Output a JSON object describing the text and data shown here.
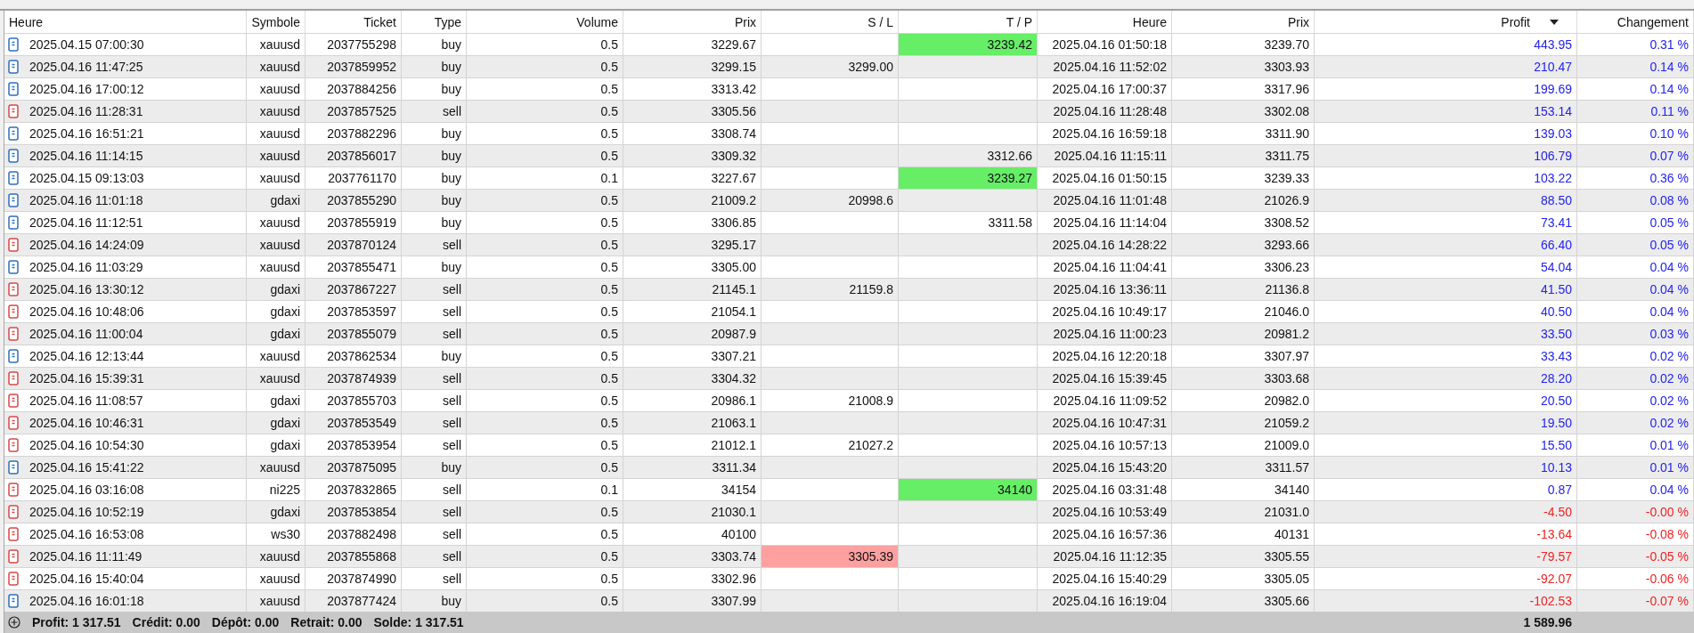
{
  "columns": [
    {
      "label": "Heure",
      "sorted": false
    },
    {
      "label": "Symbole",
      "sorted": false
    },
    {
      "label": "Ticket",
      "sorted": false
    },
    {
      "label": "Type",
      "sorted": false
    },
    {
      "label": "Volume",
      "sorted": false
    },
    {
      "label": "Prix",
      "sorted": false
    },
    {
      "label": "S / L",
      "sorted": false
    },
    {
      "label": "T / P",
      "sorted": false
    },
    {
      "label": "Heure",
      "sorted": false
    },
    {
      "label": "Prix",
      "sorted": false
    },
    {
      "label": "Profit",
      "sorted": true
    },
    {
      "label": "Changement",
      "sorted": false
    }
  ],
  "rows": [
    {
      "kind": "buy",
      "open_time": "2025.04.15 07:00:30",
      "symbol": "xauusd",
      "ticket": "2037755298",
      "type": "buy",
      "volume": "0.5",
      "open_price": "3229.67",
      "tp": {
        "value": "3239.42",
        "hit": true
      },
      "close_time": "2025.04.16 01:50:18",
      "close_price": "3239.70",
      "profit": "443.95",
      "change": "0.31 %",
      "loss": false
    },
    {
      "kind": "buy",
      "open_time": "2025.04.16 11:47:25",
      "symbol": "xauusd",
      "ticket": "2037859952",
      "type": "buy",
      "volume": "0.5",
      "open_price": "3299.15",
      "sl": {
        "value": "3299.00",
        "hit": false
      },
      "close_time": "2025.04.16 11:52:02",
      "close_price": "3303.93",
      "profit": "210.47",
      "change": "0.14 %",
      "loss": false
    },
    {
      "kind": "buy",
      "open_time": "2025.04.16 17:00:12",
      "symbol": "xauusd",
      "ticket": "2037884256",
      "type": "buy",
      "volume": "0.5",
      "open_price": "3313.42",
      "close_time": "2025.04.16 17:00:37",
      "close_price": "3317.96",
      "profit": "199.69",
      "change": "0.14 %",
      "loss": false
    },
    {
      "kind": "sell",
      "open_time": "2025.04.16 11:28:31",
      "symbol": "xauusd",
      "ticket": "2037857525",
      "type": "sell",
      "volume": "0.5",
      "open_price": "3305.56",
      "close_time": "2025.04.16 11:28:48",
      "close_price": "3302.08",
      "profit": "153.14",
      "change": "0.11 %",
      "loss": false
    },
    {
      "kind": "buy",
      "open_time": "2025.04.16 16:51:21",
      "symbol": "xauusd",
      "ticket": "2037882296",
      "type": "buy",
      "volume": "0.5",
      "open_price": "3308.74",
      "close_time": "2025.04.16 16:59:18",
      "close_price": "3311.90",
      "profit": "139.03",
      "change": "0.10 %",
      "loss": false
    },
    {
      "kind": "buy",
      "open_time": "2025.04.16 11:14:15",
      "symbol": "xauusd",
      "ticket": "2037856017",
      "type": "buy",
      "volume": "0.5",
      "open_price": "3309.32",
      "tp": {
        "value": "3312.66",
        "hit": false
      },
      "close_time": "2025.04.16 11:15:11",
      "close_price": "3311.75",
      "profit": "106.79",
      "change": "0.07 %",
      "loss": false
    },
    {
      "kind": "buy",
      "open_time": "2025.04.15 09:13:03",
      "symbol": "xauusd",
      "ticket": "2037761170",
      "type": "buy",
      "volume": "0.1",
      "open_price": "3227.67",
      "tp": {
        "value": "3239.27",
        "hit": true
      },
      "close_time": "2025.04.16 01:50:15",
      "close_price": "3239.33",
      "profit": "103.22",
      "change": "0.36 %",
      "loss": false
    },
    {
      "kind": "buy",
      "open_time": "2025.04.16 11:01:18",
      "symbol": "gdaxi",
      "ticket": "2037855290",
      "type": "buy",
      "volume": "0.5",
      "open_price": "21009.2",
      "sl": {
        "value": "20998.6",
        "hit": false
      },
      "close_time": "2025.04.16 11:01:48",
      "close_price": "21026.9",
      "profit": "88.50",
      "change": "0.08 %",
      "loss": false
    },
    {
      "kind": "buy",
      "open_time": "2025.04.16 11:12:51",
      "symbol": "xauusd",
      "ticket": "2037855919",
      "type": "buy",
      "volume": "0.5",
      "open_price": "3306.85",
      "tp": {
        "value": "3311.58",
        "hit": false
      },
      "close_time": "2025.04.16 11:14:04",
      "close_price": "3308.52",
      "profit": "73.41",
      "change": "0.05 %",
      "loss": false
    },
    {
      "kind": "sell",
      "open_time": "2025.04.16 14:24:09",
      "symbol": "xauusd",
      "ticket": "2037870124",
      "type": "sell",
      "volume": "0.5",
      "open_price": "3295.17",
      "close_time": "2025.04.16 14:28:22",
      "close_price": "3293.66",
      "profit": "66.40",
      "change": "0.05 %",
      "loss": false
    },
    {
      "kind": "buy",
      "open_time": "2025.04.16 11:03:29",
      "symbol": "xauusd",
      "ticket": "2037855471",
      "type": "buy",
      "volume": "0.5",
      "open_price": "3305.00",
      "close_time": "2025.04.16 11:04:41",
      "close_price": "3306.23",
      "profit": "54.04",
      "change": "0.04 %",
      "loss": false
    },
    {
      "kind": "sell",
      "open_time": "2025.04.16 13:30:12",
      "symbol": "gdaxi",
      "ticket": "2037867227",
      "type": "sell",
      "volume": "0.5",
      "open_price": "21145.1",
      "sl": {
        "value": "21159.8",
        "hit": false
      },
      "close_time": "2025.04.16 13:36:11",
      "close_price": "21136.8",
      "profit": "41.50",
      "change": "0.04 %",
      "loss": false
    },
    {
      "kind": "sell",
      "open_time": "2025.04.16 10:48:06",
      "symbol": "gdaxi",
      "ticket": "2037853597",
      "type": "sell",
      "volume": "0.5",
      "open_price": "21054.1",
      "close_time": "2025.04.16 10:49:17",
      "close_price": "21046.0",
      "profit": "40.50",
      "change": "0.04 %",
      "loss": false
    },
    {
      "kind": "sell",
      "open_time": "2025.04.16 11:00:04",
      "symbol": "gdaxi",
      "ticket": "2037855079",
      "type": "sell",
      "volume": "0.5",
      "open_price": "20987.9",
      "close_time": "2025.04.16 11:00:23",
      "close_price": "20981.2",
      "profit": "33.50",
      "change": "0.03 %",
      "loss": false
    },
    {
      "kind": "buy",
      "open_time": "2025.04.16 12:13:44",
      "symbol": "xauusd",
      "ticket": "2037862534",
      "type": "buy",
      "volume": "0.5",
      "open_price": "3307.21",
      "close_time": "2025.04.16 12:20:18",
      "close_price": "3307.97",
      "profit": "33.43",
      "change": "0.02 %",
      "loss": false
    },
    {
      "kind": "sell",
      "open_time": "2025.04.16 15:39:31",
      "symbol": "xauusd",
      "ticket": "2037874939",
      "type": "sell",
      "volume": "0.5",
      "open_price": "3304.32",
      "close_time": "2025.04.16 15:39:45",
      "close_price": "3303.68",
      "profit": "28.20",
      "change": "0.02 %",
      "loss": false
    },
    {
      "kind": "sell",
      "open_time": "2025.04.16 11:08:57",
      "symbol": "gdaxi",
      "ticket": "2037855703",
      "type": "sell",
      "volume": "0.5",
      "open_price": "20986.1",
      "sl": {
        "value": "21008.9",
        "hit": false
      },
      "close_time": "2025.04.16 11:09:52",
      "close_price": "20982.0",
      "profit": "20.50",
      "change": "0.02 %",
      "loss": false
    },
    {
      "kind": "sell",
      "open_time": "2025.04.16 10:46:31",
      "symbol": "gdaxi",
      "ticket": "2037853549",
      "type": "sell",
      "volume": "0.5",
      "open_price": "21063.1",
      "close_time": "2025.04.16 10:47:31",
      "close_price": "21059.2",
      "profit": "19.50",
      "change": "0.02 %",
      "loss": false
    },
    {
      "kind": "sell",
      "open_time": "2025.04.16 10:54:30",
      "symbol": "gdaxi",
      "ticket": "2037853954",
      "type": "sell",
      "volume": "0.5",
      "open_price": "21012.1",
      "sl": {
        "value": "21027.2",
        "hit": false
      },
      "close_time": "2025.04.16 10:57:13",
      "close_price": "21009.0",
      "profit": "15.50",
      "change": "0.01 %",
      "loss": false
    },
    {
      "kind": "buy",
      "open_time": "2025.04.16 15:41:22",
      "symbol": "xauusd",
      "ticket": "2037875095",
      "type": "buy",
      "volume": "0.5",
      "open_price": "3311.34",
      "close_time": "2025.04.16 15:43:20",
      "close_price": "3311.57",
      "profit": "10.13",
      "change": "0.01 %",
      "loss": false
    },
    {
      "kind": "sell",
      "open_time": "2025.04.16 03:16:08",
      "symbol": "ni225",
      "ticket": "2037832865",
      "type": "sell",
      "volume": "0.1",
      "open_price": "34154",
      "tp": {
        "value": "34140",
        "hit": true
      },
      "close_time": "2025.04.16 03:31:48",
      "close_price": "34140",
      "profit": "0.87",
      "change": "0.04 %",
      "loss": false
    },
    {
      "kind": "sell",
      "open_time": "2025.04.16 10:52:19",
      "symbol": "gdaxi",
      "ticket": "2037853854",
      "type": "sell",
      "volume": "0.5",
      "open_price": "21030.1",
      "close_time": "2025.04.16 10:53:49",
      "close_price": "21031.0",
      "profit": "-4.50",
      "change": "-0.00 %",
      "loss": true
    },
    {
      "kind": "sell",
      "open_time": "2025.04.16 16:53:08",
      "symbol": "ws30",
      "ticket": "2037882498",
      "type": "sell",
      "volume": "0.5",
      "open_price": "40100",
      "close_time": "2025.04.16 16:57:36",
      "close_price": "40131",
      "profit": "-13.64",
      "change": "-0.08 %",
      "loss": true
    },
    {
      "kind": "sell",
      "open_time": "2025.04.16 11:11:49",
      "symbol": "xauusd",
      "ticket": "2037855868",
      "type": "sell",
      "volume": "0.5",
      "open_price": "3303.74",
      "sl": {
        "value": "3305.39",
        "hit": true
      },
      "close_time": "2025.04.16 11:12:35",
      "close_price": "3305.55",
      "profit": "-79.57",
      "change": "-0.05 %",
      "loss": true
    },
    {
      "kind": "sell",
      "open_time": "2025.04.16 15:40:04",
      "symbol": "xauusd",
      "ticket": "2037874990",
      "type": "sell",
      "volume": "0.5",
      "open_price": "3302.96",
      "close_time": "2025.04.16 15:40:29",
      "close_price": "3305.05",
      "profit": "-92.07",
      "change": "-0.06 %",
      "loss": true
    },
    {
      "kind": "buy",
      "open_time": "2025.04.16 16:01:18",
      "symbol": "xauusd",
      "ticket": "2037877424",
      "type": "buy",
      "volume": "0.5",
      "open_price": "3307.99",
      "close_time": "2025.04.16 16:19:04",
      "close_price": "3305.66",
      "profit": "-102.53",
      "change": "-0.07 %",
      "loss": true
    }
  ],
  "footer": {
    "items": [
      {
        "label": "Profit:",
        "value": "1 317.51"
      },
      {
        "label": "Crédit:",
        "value": "0.00"
      },
      {
        "label": "Dépôt:",
        "value": "0.00"
      },
      {
        "label": "Retrait:",
        "value": "0.00"
      },
      {
        "label": "Solde:",
        "value": "1 317.51"
      }
    ],
    "total": "1 589.96"
  }
}
